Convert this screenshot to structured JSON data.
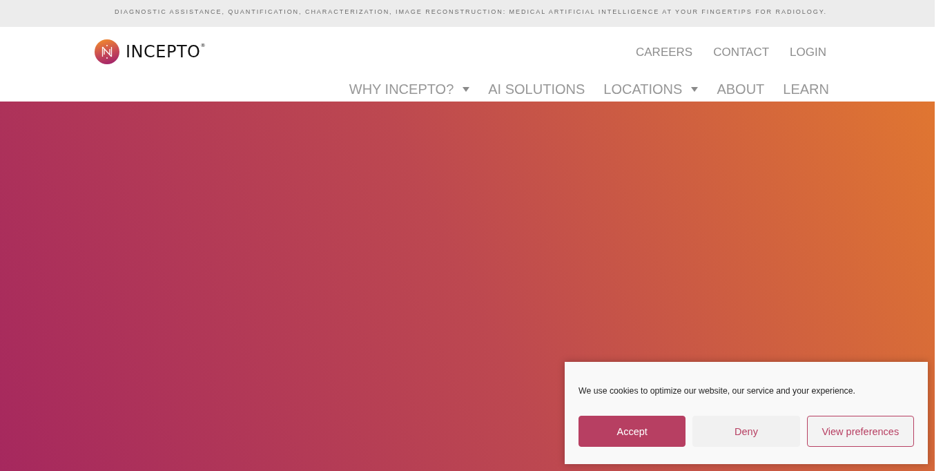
{
  "top_bar": {
    "tagline": "DIAGNOSTIC ASSISTANCE, QUANTIFICATION, CHARACTERIZATION, IMAGE RECONSTRUCTION: MEDICAL ARTIFICIAL INTELLIGENCE AT YOUR FINGERTIPS FOR RADIOLOGY."
  },
  "header": {
    "logo": {
      "text": "INCEPTO$^{®}$"
    },
    "secondary_nav": [
      {
        "label": "CAREERS"
      },
      {
        "label": "CONTACT"
      },
      {
        "label": "LOGIN"
      }
    ],
    "main_nav": [
      {
        "label": "WHY INCEPTO?",
        "has_dropdown": true
      },
      {
        "label": "AI SOLUTIONS",
        "has_dropdown": false
      },
      {
        "label": "LOCATIONS",
        "has_dropdown": true
      },
      {
        "label": "ABOUT",
        "has_dropdown": false
      },
      {
        "label": "LEARN",
        "has_dropdown": false
      }
    ]
  },
  "cookie_banner": {
    "message": "We use cookies to optimize our website, our service and your experience.",
    "buttons": [
      {
        "label": "Accept",
        "kind": "primary"
      },
      {
        "label": "Deny",
        "kind": "secondary"
      },
      {
        "label": "View preferences",
        "kind": "outline"
      }
    ]
  }
}
